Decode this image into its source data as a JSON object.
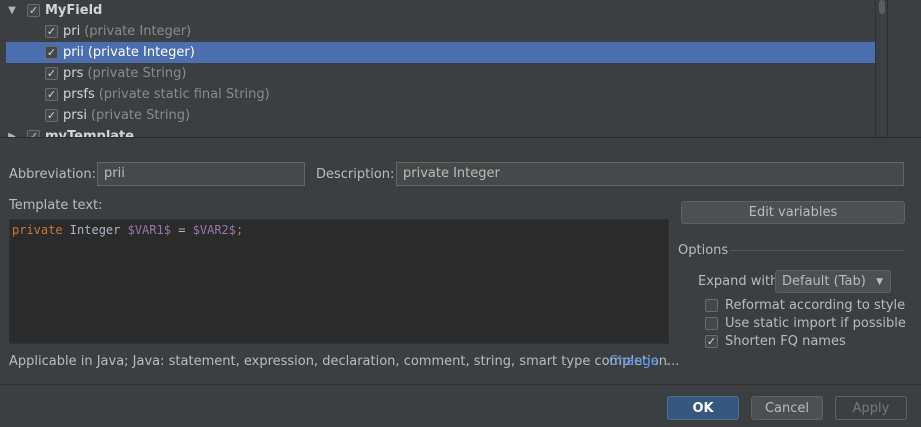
{
  "tree": {
    "rows": [
      {
        "name": "MyField",
        "desc": "",
        "checked": true,
        "expanded": true,
        "group": true
      },
      {
        "name": "pri",
        "desc": "(private Integer)",
        "checked": true
      },
      {
        "name": "prii",
        "desc": "(private Integer)",
        "checked": true,
        "selected": true
      },
      {
        "name": "prs",
        "desc": "(private String)",
        "checked": true
      },
      {
        "name": "prsfs",
        "desc": "(private static final String)",
        "checked": true
      },
      {
        "name": "prsi",
        "desc": "(private String)",
        "checked": true
      },
      {
        "name": "myTemplate",
        "desc": "",
        "checked": true,
        "expanded": false,
        "group": true
      }
    ]
  },
  "form": {
    "abbreviation_label": "Abbreviation:",
    "abbreviation_value": "prii",
    "description_label": "Description:",
    "description_value": "private Integer",
    "template_text_label": "Template text:"
  },
  "editor": {
    "tokens": [
      {
        "text": "private",
        "kind": "kw"
      },
      {
        "text": " Integer ",
        "kind": "plain"
      },
      {
        "text": "$VAR1$",
        "kind": "var"
      },
      {
        "text": " = ",
        "kind": "plain"
      },
      {
        "text": "$VAR2$",
        "kind": "var"
      },
      {
        "text": ";",
        "kind": "kw"
      }
    ]
  },
  "side": {
    "edit_variables_label": "Edit variables",
    "options_title": "Options",
    "expand_with_label": "Expand with",
    "expand_with_value": "Default (Tab)",
    "options": [
      {
        "label": "Reformat according to style",
        "checked": false
      },
      {
        "label": "Use static import if possible",
        "checked": false
      },
      {
        "label": "Shorten FQ names",
        "checked": true
      }
    ]
  },
  "applicable": {
    "text": "Applicable in Java; Java: statement, expression, declaration, comment, string, smart type completion...",
    "change_label": "Change"
  },
  "footer": {
    "ok_label": "OK",
    "cancel_label": "Cancel",
    "apply_label": "Apply"
  },
  "colors": {
    "selection": "#4b6eaf",
    "keyword": "#cc7832",
    "variable": "#9876aa",
    "link": "#589df6"
  }
}
